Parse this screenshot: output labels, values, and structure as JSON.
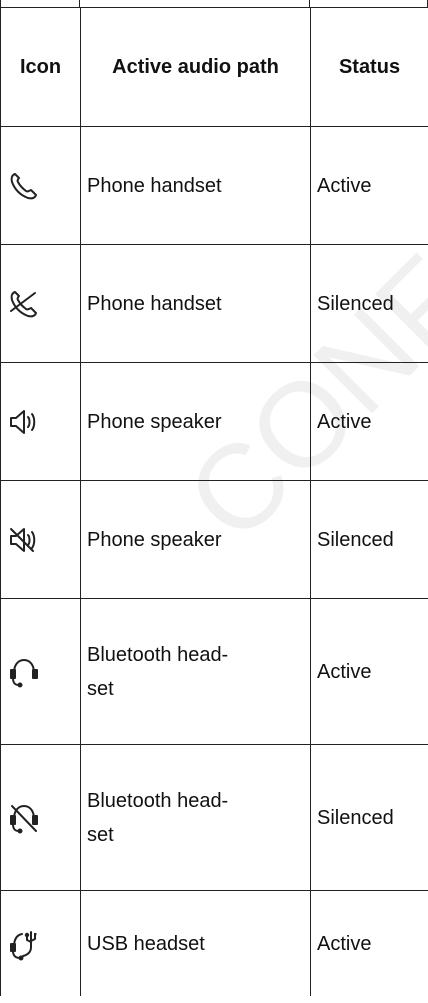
{
  "table": {
    "headers": {
      "icon": "Icon",
      "path": "Active audio path",
      "status": "Status"
    },
    "rows": [
      {
        "icon": "phone-handset-icon",
        "path": "Phone handset",
        "status": "Active"
      },
      {
        "icon": "phone-handset-silenced-icon",
        "path": "Phone handset",
        "status": "Silenced"
      },
      {
        "icon": "speaker-icon",
        "path": "Phone speaker",
        "status": "Active"
      },
      {
        "icon": "speaker-silenced-icon",
        "path": "Phone speaker",
        "status": "Silenced"
      },
      {
        "icon": "bluetooth-headset-icon",
        "path": "Bluetooth head-\nset",
        "status": "Active"
      },
      {
        "icon": "bluetooth-headset-silenced-icon",
        "path": "Bluetooth head-\nset",
        "status": "Silenced"
      },
      {
        "icon": "usb-headset-icon",
        "path": "USB headset",
        "status": "Active"
      }
    ]
  },
  "watermark": "CONFI"
}
